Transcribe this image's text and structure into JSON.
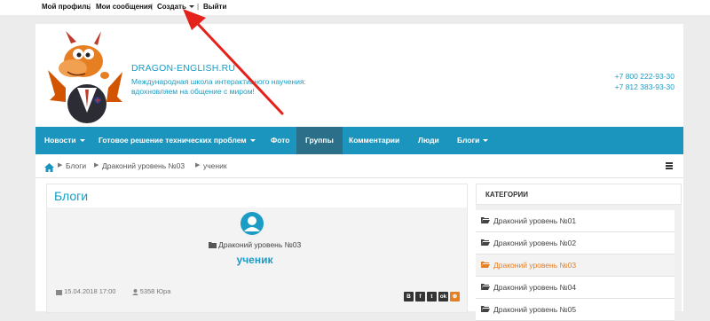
{
  "topbar": {
    "profile": "Мой профиль",
    "messages": "Мои сообщения",
    "create": "Создать",
    "logout": "Выйти",
    "separator": "|"
  },
  "header": {
    "site_title": "DRAGON-ENGLISH.RU",
    "tagline": "Международная школа интерактивного научения: вдохновляем на общение с миром!",
    "phone1": "+7 800 222-93-30",
    "phone2": "+7 812 383-93-30"
  },
  "nav": {
    "items": [
      {
        "label": "Новости"
      },
      {
        "label": "Готовое решение технических проблем"
      },
      {
        "label": "Фото"
      },
      {
        "label": "Группы"
      },
      {
        "label": "Комментарии"
      },
      {
        "label": "Люди"
      },
      {
        "label": "Блоги"
      }
    ]
  },
  "breadcrumb": {
    "items": [
      "Блоги",
      "Драконий уровень №03",
      "ученик"
    ]
  },
  "content": {
    "heading": "Блоги",
    "category": "Драконий уровень №03",
    "post_title": "ученик",
    "date": "15.04.2018 17:00",
    "author": "5358 Юра"
  },
  "social": {
    "labels": [
      "В",
      "f",
      "t",
      "ok",
      "⊕"
    ]
  },
  "sidebar": {
    "title": "КАТЕГОРИИ",
    "items": [
      "Драконий уровень №01",
      "Драконий уровень №02",
      "Драконий уровень №03",
      "Драконий уровень №04",
      "Драконий уровень №05"
    ]
  },
  "colors": {
    "brand": "#1b95bd",
    "accent_text": "#1a9cc4",
    "active_category": "#e67e22",
    "annotation_arrow": "#e5211b"
  }
}
